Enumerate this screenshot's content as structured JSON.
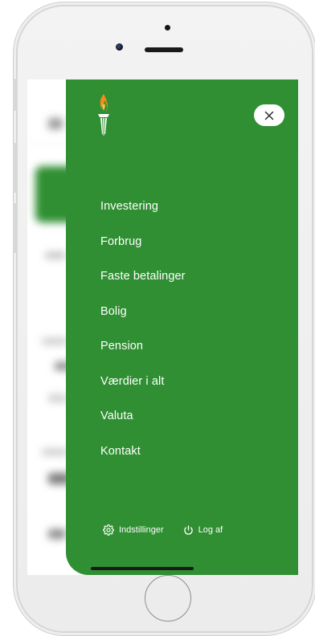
{
  "icons": {
    "logo": "torch-logo-icon",
    "close": "close-icon",
    "settings": "gear-icon",
    "logout": "power-icon"
  },
  "colors": {
    "menu_background": "#2f8f32",
    "menu_text": "#ffffff",
    "flame_orange": "#f28a1c"
  },
  "menu": {
    "items": [
      {
        "label": "Investering"
      },
      {
        "label": "Forbrug"
      },
      {
        "label": "Faste betalinger"
      },
      {
        "label": "Bolig"
      },
      {
        "label": "Pension"
      },
      {
        "label": "Værdier i alt"
      },
      {
        "label": "Valuta"
      },
      {
        "label": "Kontakt"
      }
    ],
    "footer": {
      "settings_label": "Indstillinger",
      "logout_label": "Log af"
    }
  }
}
